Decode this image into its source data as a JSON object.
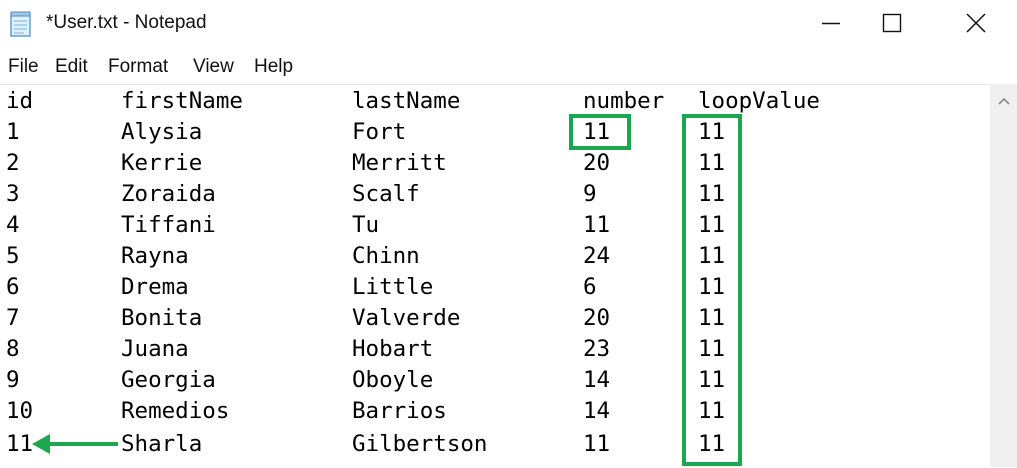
{
  "window": {
    "title": "*User.txt - Notepad"
  },
  "menu": {
    "items": [
      "File",
      "Edit",
      "Format",
      "View",
      "Help"
    ]
  },
  "editor": {
    "columns": [
      "id",
      "firstName",
      "lastName",
      "number",
      "loopValue"
    ],
    "rows": [
      [
        "1",
        "Alysia",
        "Fort",
        "11",
        "11"
      ],
      [
        "2",
        "Kerrie",
        "Merritt",
        "20",
        "11"
      ],
      [
        "3",
        "Zoraida",
        "Scalf",
        "9",
        "11"
      ],
      [
        "4",
        "Tiffani",
        "Tu",
        "11",
        "11"
      ],
      [
        "5",
        "Rayna",
        "Chinn",
        "24",
        "11"
      ],
      [
        "6",
        "Drema",
        "Little",
        "6",
        "11"
      ],
      [
        "7",
        "Bonita",
        "Valverde",
        "20",
        "11"
      ],
      [
        "8",
        "Juana",
        "Hobart",
        "23",
        "11"
      ],
      [
        "9",
        "Georgia",
        "Oboyle",
        "14",
        "11"
      ],
      [
        "10",
        "Remedios",
        "Barrios",
        "14",
        "11"
      ],
      [
        "11",
        "Sharla",
        "Gilbertson",
        "11",
        "11"
      ]
    ]
  },
  "annotations": {
    "color": "#1aa74f"
  },
  "icons": {
    "app": "notepad-icon",
    "minimize": "minimize-icon",
    "maximize": "maximize-icon",
    "close": "close-icon",
    "scroll_up": "scroll-up-arrow-icon"
  }
}
